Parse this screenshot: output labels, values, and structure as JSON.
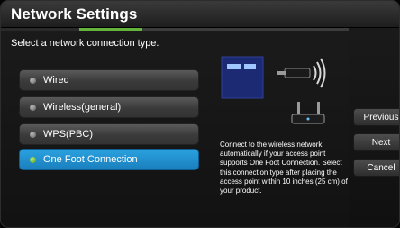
{
  "window": {
    "title": "Network Settings"
  },
  "progress": {
    "steps": 4,
    "active_step": 1
  },
  "prompt": "Select a network connection type.",
  "options": [
    {
      "label": "Wired",
      "selected": false
    },
    {
      "label": "Wireless(general)",
      "selected": false
    },
    {
      "label": "WPS(PBC)",
      "selected": false
    },
    {
      "label": "One Foot Connection",
      "selected": true
    }
  ],
  "illustration": {
    "icons": [
      "tv-screen-icon",
      "adapter-icon",
      "wireless-signal-icon",
      "access-point-icon"
    ]
  },
  "description": "Connect to the wireless network automatically if your access point supports One Foot Connection. Select this connection type after placing the access point within 10 inches (25 cm) of your product.",
  "buttons": {
    "previous": "Previous",
    "next": "Next",
    "cancel": "Cancel"
  },
  "colors": {
    "selection": "#1f8fd1",
    "progress_active": "#64b43c",
    "background": "#141414"
  }
}
